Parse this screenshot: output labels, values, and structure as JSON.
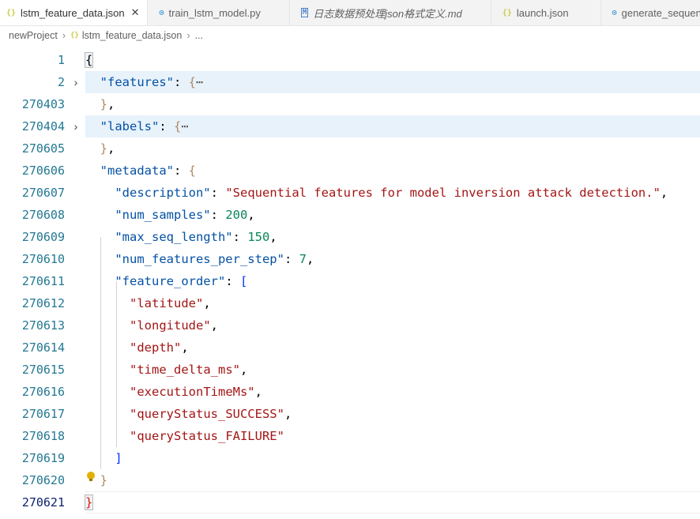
{
  "tabs": [
    {
      "label": "lstm_feature_data.json",
      "icon": "json-file-icon",
      "active": true
    },
    {
      "label": "train_lstm_model.py",
      "icon": "python-file-icon"
    },
    {
      "label": "日志数据预处理json格式定义.md",
      "icon": "markdown-file-icon"
    },
    {
      "label": "launch.json",
      "icon": "json-file-icon"
    },
    {
      "label": "generate_sequential_feat",
      "icon": "python-file-icon"
    }
  ],
  "breadcrumb": {
    "root": "newProject",
    "file": "lstm_feature_data.json",
    "more": "..."
  },
  "editor": {
    "line_numbers": [
      "1",
      "2",
      "270403",
      "270404",
      "270605",
      "270606",
      "270607",
      "270608",
      "270609",
      "270610",
      "270611",
      "270612",
      "270613",
      "270614",
      "270615",
      "270616",
      "270617",
      "270618",
      "270619",
      "270620",
      "270621"
    ],
    "keys": {
      "features": "\"features\"",
      "labels": "\"labels\"",
      "metadata": "\"metadata\"",
      "description": "\"description\"",
      "num_samples": "\"num_samples\"",
      "max_seq_length": "\"max_seq_length\"",
      "num_features_per_step": "\"num_features_per_step\"",
      "feature_order": "\"feature_order\""
    },
    "values": {
      "description": "\"Sequential features for model inversion attack detection.\"",
      "num_samples": "200",
      "max_seq_length": "150",
      "num_features_per_step": "7"
    },
    "feature_order": [
      "\"latitude\"",
      "\"longitude\"",
      "\"depth\"",
      "\"time_delta_ms\"",
      "\"executionTimeMs\"",
      "\"queryStatus_SUCCESS\"",
      "\"queryStatus_FAILURE\""
    ],
    "folded_ellipsis": "⋯"
  }
}
